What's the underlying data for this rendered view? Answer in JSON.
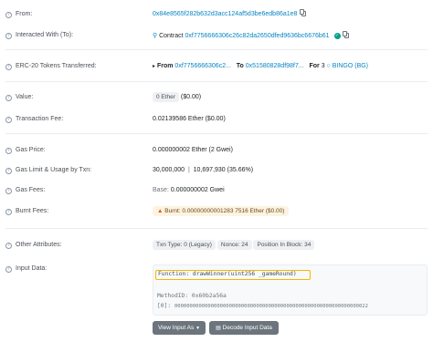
{
  "rows": {
    "from": {
      "label": "From:",
      "address": "0x84e8565f282b632d3acc124af5d3be6edb86a1e8"
    },
    "interacted": {
      "label": "Interacted With (To):",
      "prefix": "Contract",
      "address": "0xf7756666306c26c82da2650dfed9636bc6676b61"
    },
    "erc20": {
      "label": "ERC-20 Tokens Transferred:",
      "from_label": "From",
      "from_address": "0xf7756666306c2...",
      "to_label": "To",
      "to_address": "0x51580828df98f7...",
      "for_label": "For",
      "amount": "3",
      "token": "BINGO (BG)"
    },
    "value": {
      "label": "Value:",
      "badge": "0 Ether",
      "usd": "($0.00)"
    },
    "fee": {
      "label": "Transaction Fee:",
      "text": "0.02139586 Ether ($0.00)"
    },
    "gas_price": {
      "label": "Gas Price:",
      "text": "0.000000002 Ether (2 Gwei)"
    },
    "gas_limit": {
      "label": "Gas Limit & Usage by Txn:",
      "limit": "30,000,000",
      "sep": "|",
      "usage": "10,697,930 (35.66%)"
    },
    "gas_fees": {
      "label": "Gas Fees:",
      "base_label": "Base:",
      "base_value": "0.000000002 Gwei"
    },
    "burnt": {
      "label": "Burnt Fees:",
      "text": "Burnt: 0.00000000001283 7516 Ether ($0.00)"
    },
    "other": {
      "label": "Other Attributes:",
      "txn_type": "Txn Type: 0 (Legacy)",
      "nonce": "Nonce: 24",
      "position": "Position In Block: 34"
    },
    "input": {
      "label": "Input Data:",
      "function": "Function: drawWinner(uint256 _gameRound)",
      "method_id": "MethodID: 0x60b2a56a",
      "param_index": "[0]:",
      "param_value": "0000000000000000000000000000000000000000000000000000000000000022",
      "view_button": "View Input As",
      "decode_button": "Decode Input Data"
    }
  },
  "colors": {
    "link": "#0784c3",
    "highlight": "#f5b800",
    "verified": "#00a186"
  },
  "icons": [
    "help-icon",
    "copy-icon",
    "contract-icon",
    "check-icon",
    "caret-icon",
    "token-icon",
    "fire-icon",
    "decode-icon"
  ]
}
